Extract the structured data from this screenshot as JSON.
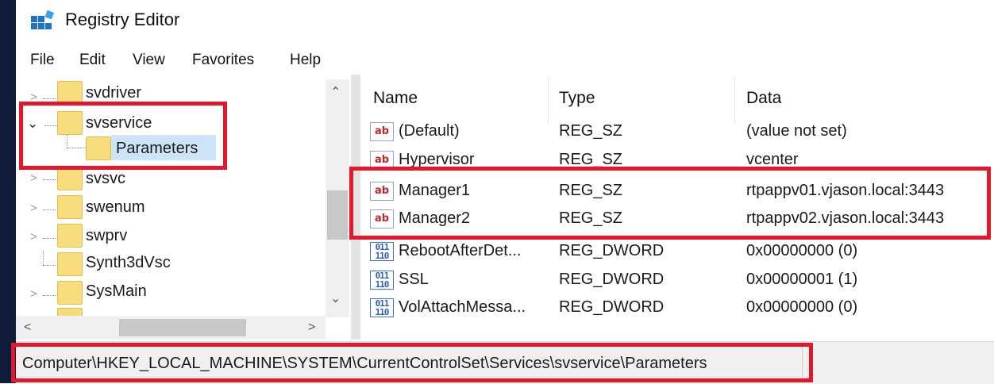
{
  "window": {
    "title": "Registry Editor",
    "icon": "registry-editor-icon"
  },
  "menu": [
    "File",
    "Edit",
    "View",
    "Favorites",
    "Help"
  ],
  "tree": {
    "items": [
      {
        "label": "svdriver",
        "expander": "collapsed"
      },
      {
        "label": "svservice",
        "expander": "expanded"
      },
      {
        "label": "Parameters",
        "expander": "none",
        "selected": true
      },
      {
        "label": "svsvc",
        "expander": "collapsed"
      },
      {
        "label": "swenum",
        "expander": "collapsed"
      },
      {
        "label": "swprv",
        "expander": "collapsed"
      },
      {
        "label": "Synth3dVsc",
        "expander": "none"
      },
      {
        "label": "SysMain",
        "expander": "collapsed"
      }
    ]
  },
  "list": {
    "columns": [
      "Name",
      "Type",
      "Data"
    ],
    "rows": [
      {
        "icon": "string-value-icon",
        "name": "(Default)",
        "type": "REG_SZ",
        "data": "(value not set)"
      },
      {
        "icon": "string-value-icon",
        "name": "Hypervisor",
        "type": "REG_SZ",
        "data": "vcenter"
      },
      {
        "icon": "string-value-icon",
        "name": "Manager1",
        "type": "REG_SZ",
        "data": "rtpappv01.vjason.local:3443"
      },
      {
        "icon": "string-value-icon",
        "name": "Manager2",
        "type": "REG_SZ",
        "data": "rtpappv02.vjason.local:3443"
      },
      {
        "icon": "dword-value-icon",
        "name": "RebootAfterDet...",
        "type": "REG_DWORD",
        "data": "0x00000000 (0)"
      },
      {
        "icon": "dword-value-icon",
        "name": "SSL",
        "type": "REG_DWORD",
        "data": "0x00000001 (1)"
      },
      {
        "icon": "dword-value-icon",
        "name": "VolAttachMessa...",
        "type": "REG_DWORD",
        "data": "0x00000000 (0)"
      }
    ]
  },
  "icon_text": {
    "string": "ab",
    "dword": "011\n110"
  },
  "statusbar": {
    "path": "Computer\\HKEY_LOCAL_MACHINE\\SYSTEM\\CurrentControlSet\\Services\\svservice\\Parameters"
  },
  "colors": {
    "highlight": "#e3182d",
    "selection": "#cde3f7",
    "folder": "#f6dc7d"
  }
}
